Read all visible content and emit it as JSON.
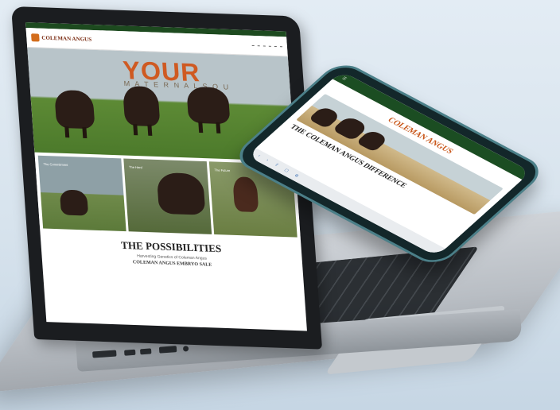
{
  "laptop_site": {
    "logo": "COLEMAN ANGUS",
    "hero_title": "YOUR",
    "hero_subtitle": "M A T E R N A L   S O U",
    "tiles": [
      "The Commitment",
      "The Herd",
      "The Future"
    ],
    "section_title": "THE POSSIBILITIES",
    "section_subtitle": "Harvesting Genetics of Coleman Angus",
    "sale_title": "COLEMAN ANGUS EMBRYO SALE"
  },
  "phone_site": {
    "logo": "COLEMAN ANGUS",
    "heading": "THE COLEMAN ANGUS DIFFERENCE"
  },
  "colors": {
    "brand_orange": "#cf5a22",
    "brand_green": "#1d4a1f",
    "phone_frame": "#4b7f88"
  }
}
